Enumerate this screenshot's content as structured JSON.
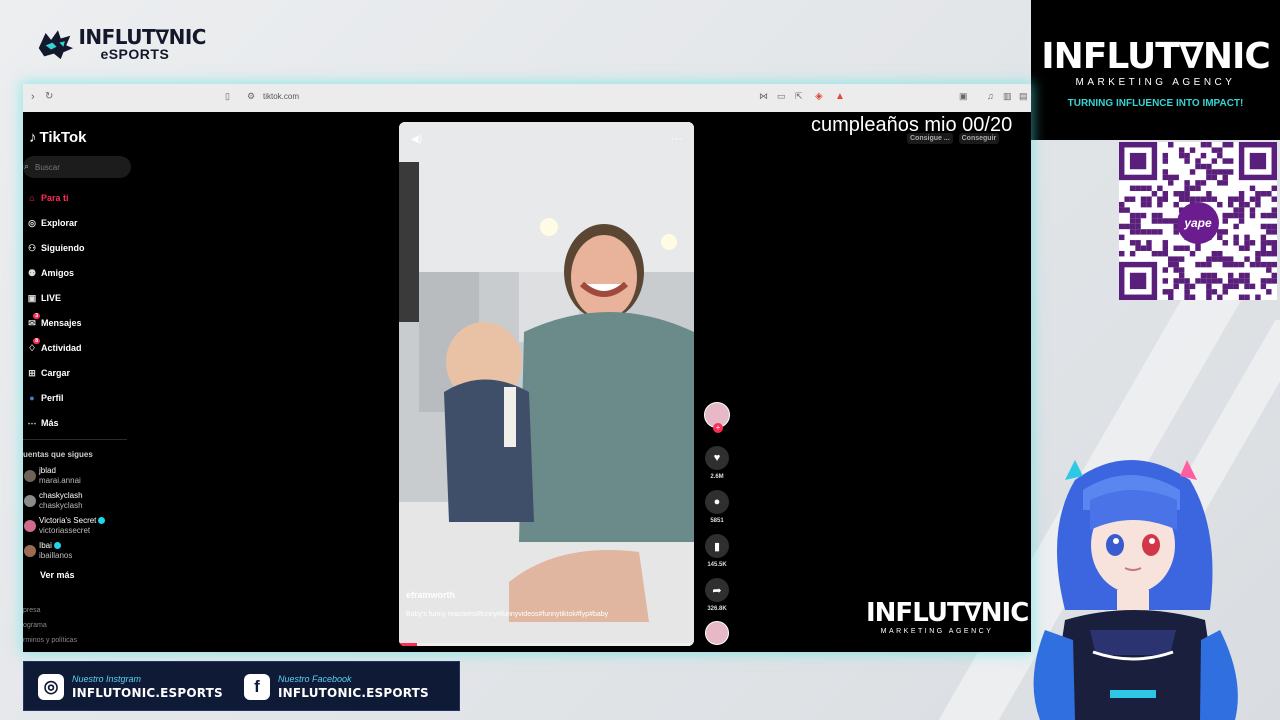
{
  "brand": {
    "name": "INFLUT∇NIC",
    "sub": "eSPORTS"
  },
  "agency": {
    "name": "INFLUT∇NIC",
    "sub": "MARKETING AGENCY",
    "tagline": "TURNING INFLUENCE INTO IMPACT!"
  },
  "qr": {
    "label": "yape",
    "currency": "S/"
  },
  "browser": {
    "url": "tiktok.com"
  },
  "tiktok": {
    "logo": "TikTok",
    "search_placeholder": "Buscar",
    "nav": [
      {
        "label": "Para ti",
        "icon": "home-icon",
        "active": true
      },
      {
        "label": "Explorar",
        "icon": "compass-icon"
      },
      {
        "label": "Siguiendo",
        "icon": "following-icon"
      },
      {
        "label": "Amigos",
        "icon": "friends-icon"
      },
      {
        "label": "LIVE",
        "icon": "live-icon"
      },
      {
        "label": "Mensajes",
        "icon": "messages-icon",
        "badge": "3"
      },
      {
        "label": "Actividad",
        "icon": "activity-icon",
        "badge": "8"
      },
      {
        "label": "Cargar",
        "icon": "upload-icon"
      },
      {
        "label": "Perfil",
        "icon": "profile-icon"
      },
      {
        "label": "Más",
        "icon": "more-icon"
      }
    ],
    "following_title": "uentas que sigues",
    "accounts": [
      {
        "name": "jblad",
        "handle": "marai.annai",
        "verified": false
      },
      {
        "name": "chaskyclash",
        "handle": "chaskyclash",
        "verified": false
      },
      {
        "name": "Victoria's Secret",
        "handle": "victoriassecret",
        "verified": true
      },
      {
        "name": "Ibai",
        "handle": "ibaillanos",
        "verified": true
      }
    ],
    "see_more": "Ver más",
    "footer": [
      "presa",
      "ograma",
      "rminos y políticas"
    ],
    "chips": [
      "Consigue ...",
      "Conseguir"
    ]
  },
  "video": {
    "username": "efrainworth",
    "description": "Baby's funny reactions#funny#funnyvideos#funnytiktok#fyp#baby",
    "translate": "Ver traducción",
    "progress": 0.06,
    "actions": {
      "likes": "2.6M",
      "comments": "5851",
      "saves": "145.5K",
      "shares": "326.8K"
    }
  },
  "overlay": {
    "text": "cumpleaños mio 00/20"
  },
  "agency_watermark": {
    "name": "INFLUT∇NIC",
    "sub": "MARKETING AGENCY"
  },
  "social": {
    "instagram": {
      "label": "Nuestro Instgram",
      "handle": "INFLUTONIC.ESPORTS"
    },
    "facebook": {
      "label": "Nuestro Facebook",
      "handle": "INFLUTONIC.ESPORTS"
    }
  },
  "colors": {
    "accent_red": "#fe2c55",
    "cyan": "#36d3d3",
    "navy": "#0f1a36",
    "yape_purple": "#6b1c8e"
  }
}
